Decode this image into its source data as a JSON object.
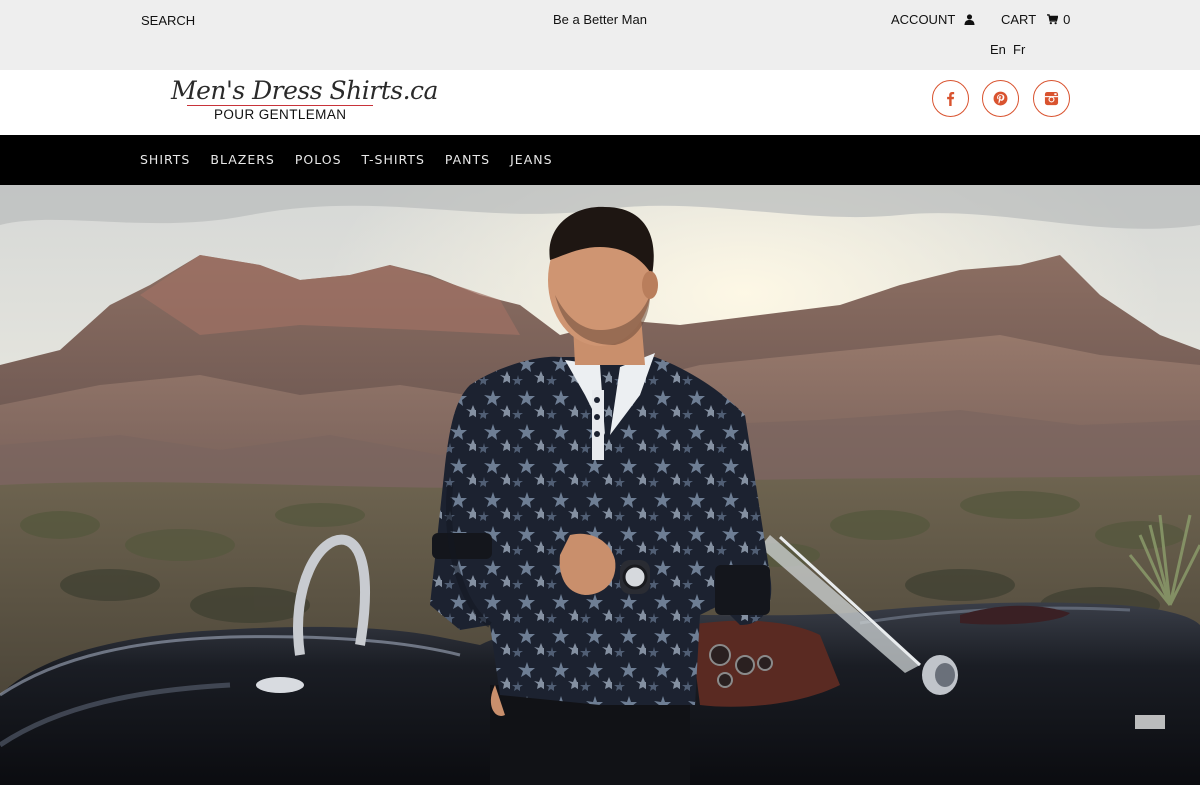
{
  "topbar": {
    "search_label": "SEARCH",
    "tagline": "Be a Better Man",
    "account_label": "ACCOUNT",
    "account_icon": "user-icon",
    "cart_label": "CART",
    "cart_icon": "shopping-cart-icon",
    "cart_count": "0",
    "languages": [
      "En",
      "Fr"
    ],
    "background_color": "#eeeeee"
  },
  "brand": {
    "logo_script": "Men's Dress Shirts.ca",
    "logo_subtitle": "POUR GENTLEMAN",
    "accent_color": "#d9532f"
  },
  "social": [
    {
      "icon": "facebook-icon"
    },
    {
      "icon": "pinterest-icon"
    },
    {
      "icon": "instagram-icon"
    }
  ],
  "nav": {
    "items": [
      "SHIRTS",
      "BLAZERS",
      "POLOS",
      "T-SHIRTS",
      "PANTS",
      "JEANS"
    ],
    "background_color": "#000000"
  },
  "hero": {
    "image": "hero-photo"
  }
}
